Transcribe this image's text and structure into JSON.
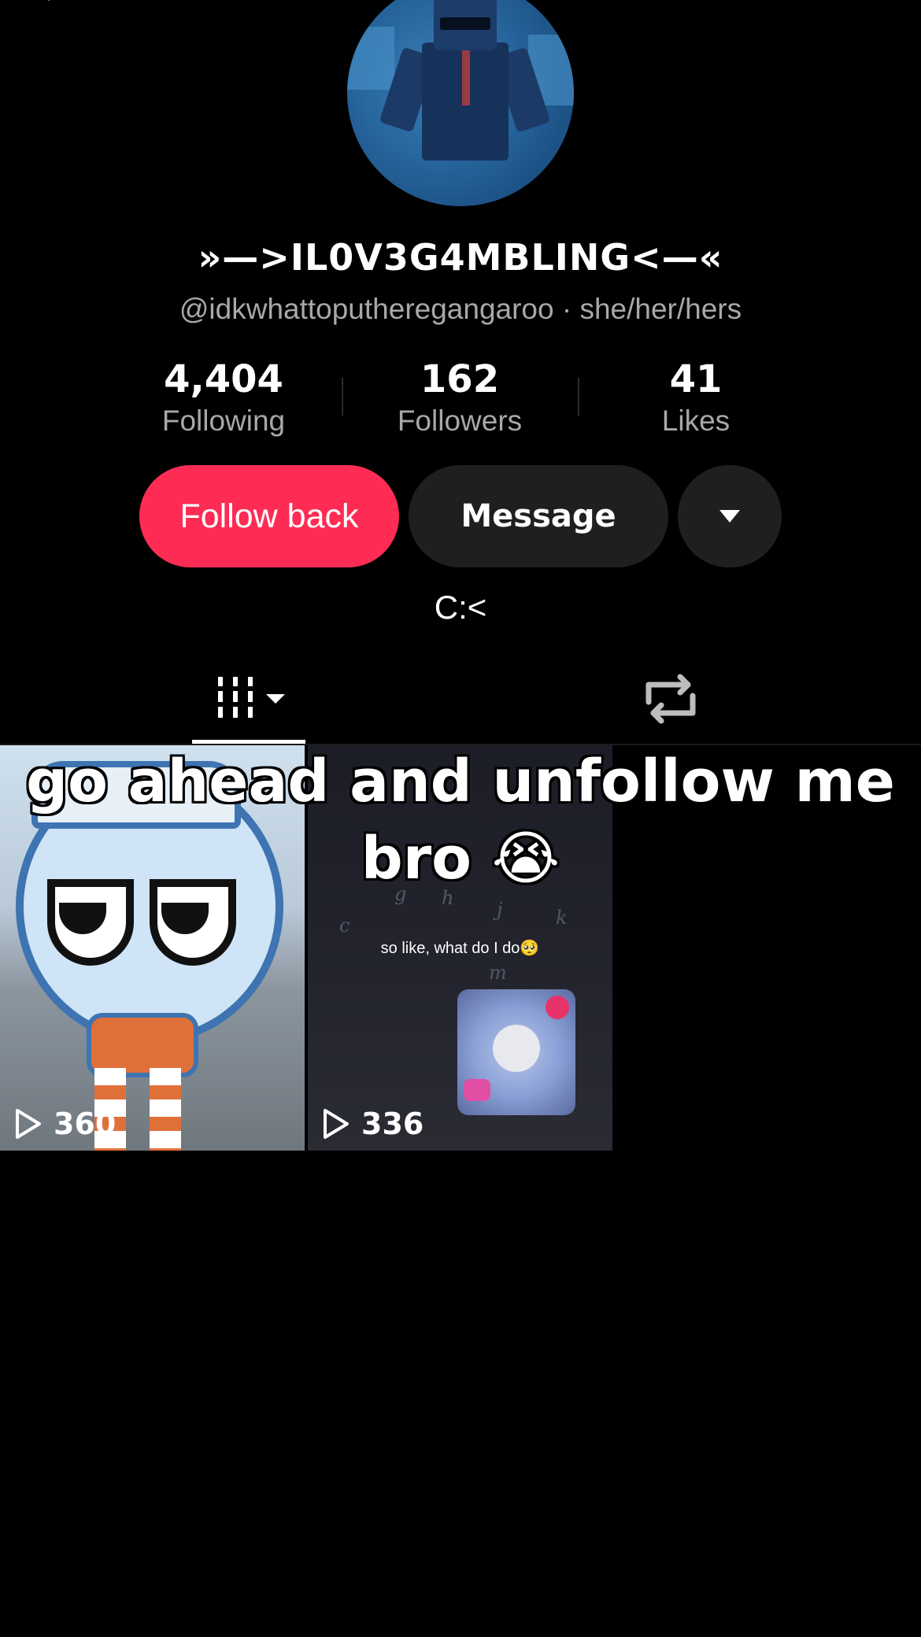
{
  "profile": {
    "display_name": "»—>IL0V3G4MBLING<—«",
    "handle_line": "@idkwhattoputheregangaroo · she/her/hers",
    "bio": "C:<"
  },
  "stats": {
    "following": {
      "value": "4,404",
      "label": "Following"
    },
    "followers": {
      "value": "162",
      "label": "Followers"
    },
    "likes": {
      "value": "41",
      "label": "Likes"
    }
  },
  "actions": {
    "follow_back": "Follow back",
    "message": "Message"
  },
  "tabs": {
    "videos_icon": "grid-icon",
    "reposts_icon": "repost-icon"
  },
  "videos": [
    {
      "views": "360"
    },
    {
      "views": "336",
      "caption": "so like, what do I do🥺"
    }
  ],
  "overlay_caption": "go ahead and unfollow me bro 😭",
  "colors": {
    "accent": "#fe2c55",
    "button_dark": "#1f1f1f",
    "muted_text": "#a8a8a8"
  }
}
